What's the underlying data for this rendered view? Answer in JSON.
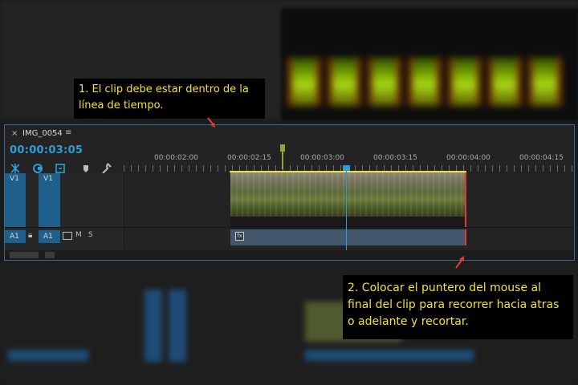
{
  "background": {
    "description_colors": {
      "panel_border": "#3b6c8e",
      "accent_blue": "#2f9ed8",
      "clip_trim_red": "#e23b3b",
      "callout_text": "#f2e23a"
    }
  },
  "timeline": {
    "tab": {
      "close_symbol": "×",
      "title": "IMG_0054",
      "menu_symbol": "≡"
    },
    "timecode": "00:00:03:05",
    "ruler_labels": [
      "00:00:02:00",
      "00:00:02:15",
      "00:00:03:00",
      "00:00:03:15",
      "00:00:04:00",
      "00:00:04:15"
    ],
    "tracks": {
      "video": {
        "source_label": "V1",
        "target_label": "V1"
      },
      "audio": {
        "source_label": "A1",
        "target_label": "A1",
        "mute": "M",
        "solo": "S"
      }
    },
    "clip_fx_badge": "fx"
  },
  "callouts": {
    "step1": "1. El clip debe estar dentro de la línea de tiempo.",
    "step2": "2. Colocar el puntero del mouse al final del clip para recorrer hacia atras o adelante y recortar."
  },
  "icons": [
    "close-icon",
    "menu-icon",
    "snap-icon",
    "linked-selection-icon",
    "add-marker-icon",
    "marker-icon",
    "wrench-icon",
    "lock-icon",
    "fx-icon",
    "playhead-icon",
    "arrow-icon"
  ]
}
